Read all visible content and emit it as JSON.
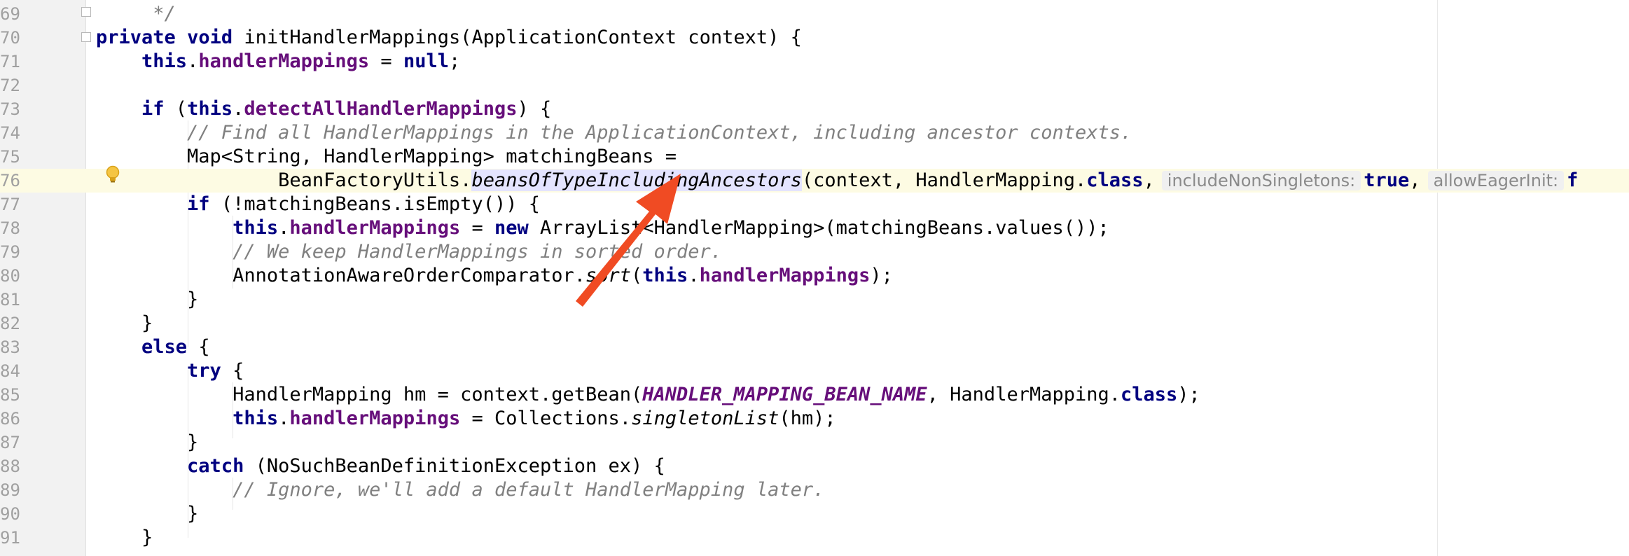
{
  "editor": {
    "lines": [
      {
        "num": "69",
        "segments": [
          {
            "t": "    ",
            "c": ""
          },
          {
            "t": " */",
            "c": "cm"
          }
        ]
      },
      {
        "num": "70",
        "segments": [
          {
            "t": "private",
            "c": "kw"
          },
          {
            "t": " ",
            "c": ""
          },
          {
            "t": "void",
            "c": "kw"
          },
          {
            "t": " initHandlerMappings(ApplicationContext context) {",
            "c": ""
          }
        ]
      },
      {
        "num": "71",
        "segments": [
          {
            "t": "    ",
            "c": ""
          },
          {
            "t": "this",
            "c": "kw"
          },
          {
            "t": ".",
            "c": ""
          },
          {
            "t": "handlerMappings",
            "c": "field"
          },
          {
            "t": " = ",
            "c": ""
          },
          {
            "t": "null",
            "c": "kw"
          },
          {
            "t": ";",
            "c": ""
          }
        ]
      },
      {
        "num": "72",
        "segments": []
      },
      {
        "num": "73",
        "segments": [
          {
            "t": "    ",
            "c": ""
          },
          {
            "t": "if",
            "c": "kw"
          },
          {
            "t": " (",
            "c": ""
          },
          {
            "t": "this",
            "c": "kw"
          },
          {
            "t": ".",
            "c": ""
          },
          {
            "t": "detectAllHandlerMappings",
            "c": "field"
          },
          {
            "t": ") {",
            "c": ""
          }
        ]
      },
      {
        "num": "74",
        "segments": [
          {
            "t": "        ",
            "c": ""
          },
          {
            "t": "// Find all HandlerMappings in the ApplicationContext, including ancestor contexts.",
            "c": "cm"
          }
        ]
      },
      {
        "num": "75",
        "segments": [
          {
            "t": "        Map<String, HandlerMapping> matchingBeans =",
            "c": ""
          }
        ]
      },
      {
        "num": "76",
        "current": true,
        "segments": [
          {
            "t": "                BeanFactoryUtils.",
            "c": ""
          },
          {
            "t": "beansOfTypeIncludingAncestors",
            "c": "static-m hl"
          },
          {
            "t": "(context, HandlerMapping.",
            "c": ""
          },
          {
            "t": "class",
            "c": "kw"
          },
          {
            "t": ",",
            "c": ""
          },
          {
            "t": "includeNonSingletons:",
            "c": "hint"
          },
          {
            "t": "true",
            "c": "kw"
          },
          {
            "t": ",",
            "c": ""
          },
          {
            "t": "allowEagerInit:",
            "c": "hint"
          },
          {
            "t": "f",
            "c": "kw"
          }
        ]
      },
      {
        "num": "77",
        "segments": [
          {
            "t": "        ",
            "c": ""
          },
          {
            "t": "if",
            "c": "kw"
          },
          {
            "t": " (!matchingBeans.isEmpty()) {",
            "c": ""
          }
        ]
      },
      {
        "num": "78",
        "segments": [
          {
            "t": "            ",
            "c": ""
          },
          {
            "t": "this",
            "c": "kw"
          },
          {
            "t": ".",
            "c": ""
          },
          {
            "t": "handlerMappings",
            "c": "field"
          },
          {
            "t": " = ",
            "c": ""
          },
          {
            "t": "new",
            "c": "kw"
          },
          {
            "t": " ArrayList<HandlerMapping>(matchingBeans.values());",
            "c": ""
          }
        ]
      },
      {
        "num": "79",
        "segments": [
          {
            "t": "            ",
            "c": ""
          },
          {
            "t": "// We keep HandlerMappings in sorted order.",
            "c": "cm"
          }
        ]
      },
      {
        "num": "80",
        "segments": [
          {
            "t": "            AnnotationAwareOrderComparator.",
            "c": ""
          },
          {
            "t": "sort",
            "c": "static-m"
          },
          {
            "t": "(",
            "c": ""
          },
          {
            "t": "this",
            "c": "kw"
          },
          {
            "t": ".",
            "c": ""
          },
          {
            "t": "handlerMappings",
            "c": "field"
          },
          {
            "t": ");",
            "c": ""
          }
        ]
      },
      {
        "num": "81",
        "segments": [
          {
            "t": "        }",
            "c": ""
          }
        ]
      },
      {
        "num": "82",
        "segments": [
          {
            "t": "    }",
            "c": ""
          }
        ]
      },
      {
        "num": "83",
        "segments": [
          {
            "t": "    ",
            "c": ""
          },
          {
            "t": "else",
            "c": "kw"
          },
          {
            "t": " {",
            "c": ""
          }
        ]
      },
      {
        "num": "84",
        "segments": [
          {
            "t": "        ",
            "c": ""
          },
          {
            "t": "try",
            "c": "kw"
          },
          {
            "t": " {",
            "c": ""
          }
        ]
      },
      {
        "num": "85",
        "segments": [
          {
            "t": "            HandlerMapping hm = context.getBean(",
            "c": ""
          },
          {
            "t": "HANDLER_MAPPING_BEAN_NAME",
            "c": "const"
          },
          {
            "t": ", HandlerMapping.",
            "c": ""
          },
          {
            "t": "class",
            "c": "kw"
          },
          {
            "t": ");",
            "c": ""
          }
        ]
      },
      {
        "num": "86",
        "segments": [
          {
            "t": "            ",
            "c": ""
          },
          {
            "t": "this",
            "c": "kw"
          },
          {
            "t": ".",
            "c": ""
          },
          {
            "t": "handlerMappings",
            "c": "field"
          },
          {
            "t": " = Collections.",
            "c": ""
          },
          {
            "t": "singletonList",
            "c": "static-m"
          },
          {
            "t": "(hm);",
            "c": ""
          }
        ]
      },
      {
        "num": "87",
        "segments": [
          {
            "t": "        }",
            "c": ""
          }
        ]
      },
      {
        "num": "88",
        "segments": [
          {
            "t": "        ",
            "c": ""
          },
          {
            "t": "catch",
            "c": "kw"
          },
          {
            "t": " (NoSuchBeanDefinitionException ex) {",
            "c": ""
          }
        ]
      },
      {
        "num": "89",
        "segments": [
          {
            "t": "            ",
            "c": ""
          },
          {
            "t": "// Ignore, we'll add a default HandlerMapping later.",
            "c": "cm"
          }
        ]
      },
      {
        "num": "90",
        "segments": [
          {
            "t": "        }",
            "c": ""
          }
        ]
      },
      {
        "num": "91",
        "segments": [
          {
            "t": "    }",
            "c": ""
          }
        ]
      }
    ],
    "icons": {
      "intention": "lightbulb-icon",
      "annotation_arrow": "red-arrow-icon"
    },
    "colors": {
      "keyword": "#000080",
      "field": "#660e7a",
      "comment": "#808080",
      "current_line": "#fdfbe3",
      "arrow": "#f04b23"
    }
  }
}
